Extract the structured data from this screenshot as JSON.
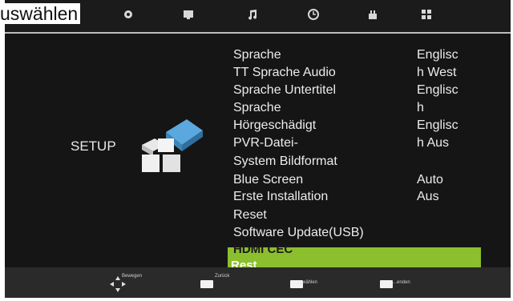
{
  "header": {
    "title": "uswählen",
    "tabs": [
      {
        "name": "picture-icon"
      },
      {
        "name": "sound-icon"
      },
      {
        "name": "music-icon"
      },
      {
        "name": "clock-icon"
      },
      {
        "name": "lock-icon"
      },
      {
        "name": "setup-icon"
      }
    ]
  },
  "side": {
    "label": "SETUP",
    "icon": "setup-blocks-icon"
  },
  "menu": {
    "items": [
      {
        "label": "Sprache",
        "value": "Englisc"
      },
      {
        "label": "TT Sprache Audio",
        "value": "h West"
      },
      {
        "label": "Sprache Untertitel",
        "value": "Englisc"
      },
      {
        "label": "Sprache",
        "value": "h"
      },
      {
        "label": "Hörgeschädigt",
        "value": "Englisc"
      },
      {
        "label": "PVR-Datei-",
        "value": "h Aus"
      },
      {
        "label": "System Bildformat",
        "value": ""
      },
      {
        "label": "Blue Screen",
        "value": "Auto"
      },
      {
        "label": "Erste Installation",
        "value": "Aus"
      },
      {
        "label": "Reset",
        "value": ""
      },
      {
        "label": "Software Update(USB)",
        "value": ""
      }
    ],
    "selected": {
      "label": "HDMI CEC",
      "sublabel": "Rest"
    }
  },
  "footer": {
    "hints": [
      {
        "label": "Bewegen",
        "icon": "dpad-icon"
      },
      {
        "label": "Zurück",
        "icon": "key-icon"
      },
      {
        "label": "...wählen",
        "icon": "key-icon"
      },
      {
        "label": "...enden",
        "icon": "key-icon"
      }
    ]
  },
  "colors": {
    "accent": "#8cbf2d",
    "background": "#151515"
  }
}
